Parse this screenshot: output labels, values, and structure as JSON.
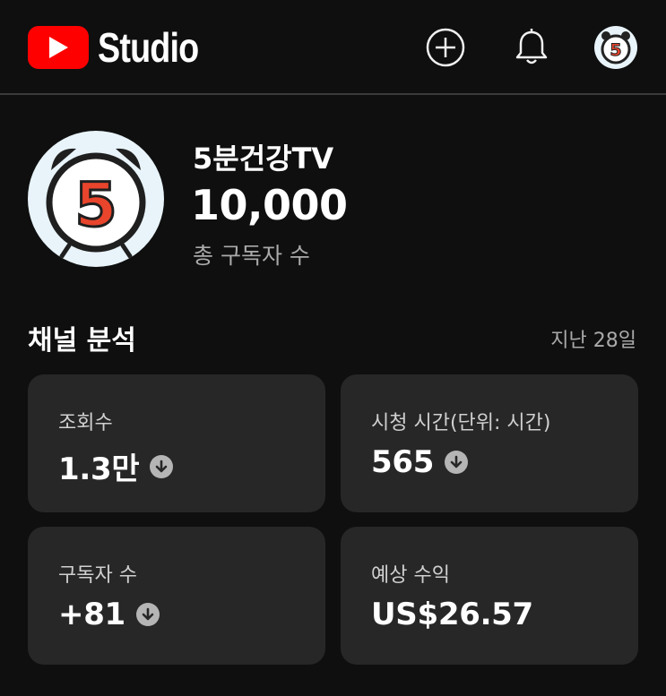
{
  "header": {
    "brand": "Studio",
    "icons": [
      "youtube-logo-icon",
      "create-plus-icon",
      "bell-icon",
      "account-avatar"
    ]
  },
  "channel": {
    "avatar_text": "5",
    "name": "5분건강TV",
    "subscribers": "10,000",
    "subscribers_label": "총 구독자 수"
  },
  "analytics": {
    "title": "채널 분석",
    "range": "지난 28일",
    "cards": [
      {
        "label": "조회수",
        "value": "1.3만",
        "trend": "down"
      },
      {
        "label": "시청 시간(단위: 시간)",
        "value": "565",
        "trend": "down"
      },
      {
        "label": "구독자 수",
        "value": "+81",
        "trend": "down"
      },
      {
        "label": "예상 수익",
        "value": "US$26.57",
        "trend": ""
      }
    ]
  },
  "colors": {
    "background": "#0f0f0f",
    "card": "#272727",
    "brand_red": "#ff0000",
    "avatar_number": "#e8452c"
  }
}
